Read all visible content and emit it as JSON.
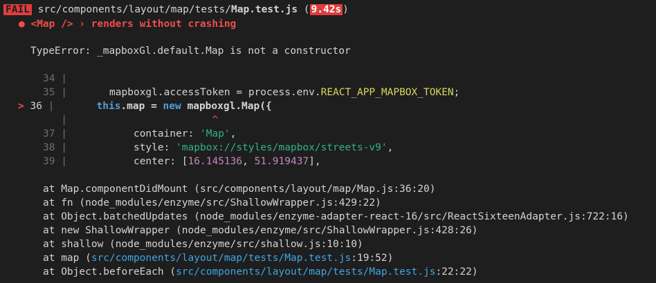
{
  "header": {
    "badge": "FAIL",
    "path_prefix": "src/components/layout/map/tests/",
    "file": "Map.test.js",
    "paren_open": "(",
    "time": "9.42s",
    "paren_close": ")"
  },
  "test": {
    "bullet": "●",
    "name": "<Map /> › renders without crashing"
  },
  "error": {
    "message": "TypeError: _mapboxGl.default.Map is not a constructor"
  },
  "code": {
    "marker": ">",
    "lines": [
      {
        "num": "34"
      },
      {
        "num": "35",
        "p1": "mapboxgl.accessToken = process.env.",
        "env": "REACT_APP_MAPBOX_TOKEN",
        "p2": ";"
      },
      {
        "num": "36",
        "kw1": "this",
        "p1": ".map = ",
        "kw2": "new",
        "fn": "mapboxgl.Map",
        "p2": "({"
      },
      {
        "caret": "^"
      },
      {
        "num": "37",
        "p1": "container: ",
        "str": "'Map'",
        "p2": ","
      },
      {
        "num": "38",
        "p1": "style: ",
        "str": "'mapbox://styles/mapbox/streets-v9'",
        "p2": ","
      },
      {
        "num": "39",
        "p1": "center: [",
        "n1": "16.145136",
        "sep": ", ",
        "n2": "51.919437",
        "p2": "],"
      }
    ]
  },
  "stack": [
    {
      "text": "at Map.componentDidMount (src/components/layout/map/Map.js:36:20)"
    },
    {
      "text": "at fn (node_modules/enzyme/src/ShallowWrapper.js:429:22)"
    },
    {
      "text": "at Object.batchedUpdates (node_modules/enzyme-adapter-react-16/src/ReactSixteenAdapter.js:722:16)"
    },
    {
      "text": "at new ShallowWrapper (node_modules/enzyme/src/ShallowWrapper.js:428:26)"
    },
    {
      "text": "at shallow (node_modules/enzyme/src/shallow.js:10:10)"
    },
    {
      "pre": "at map (",
      "link": "src/components/layout/map/tests/Map.test.js",
      "post": ":19:52)"
    },
    {
      "pre": "at Object.beforeEach (",
      "link": "src/components/layout/map/tests/Map.test.js",
      "post": ":22:22)"
    }
  ]
}
